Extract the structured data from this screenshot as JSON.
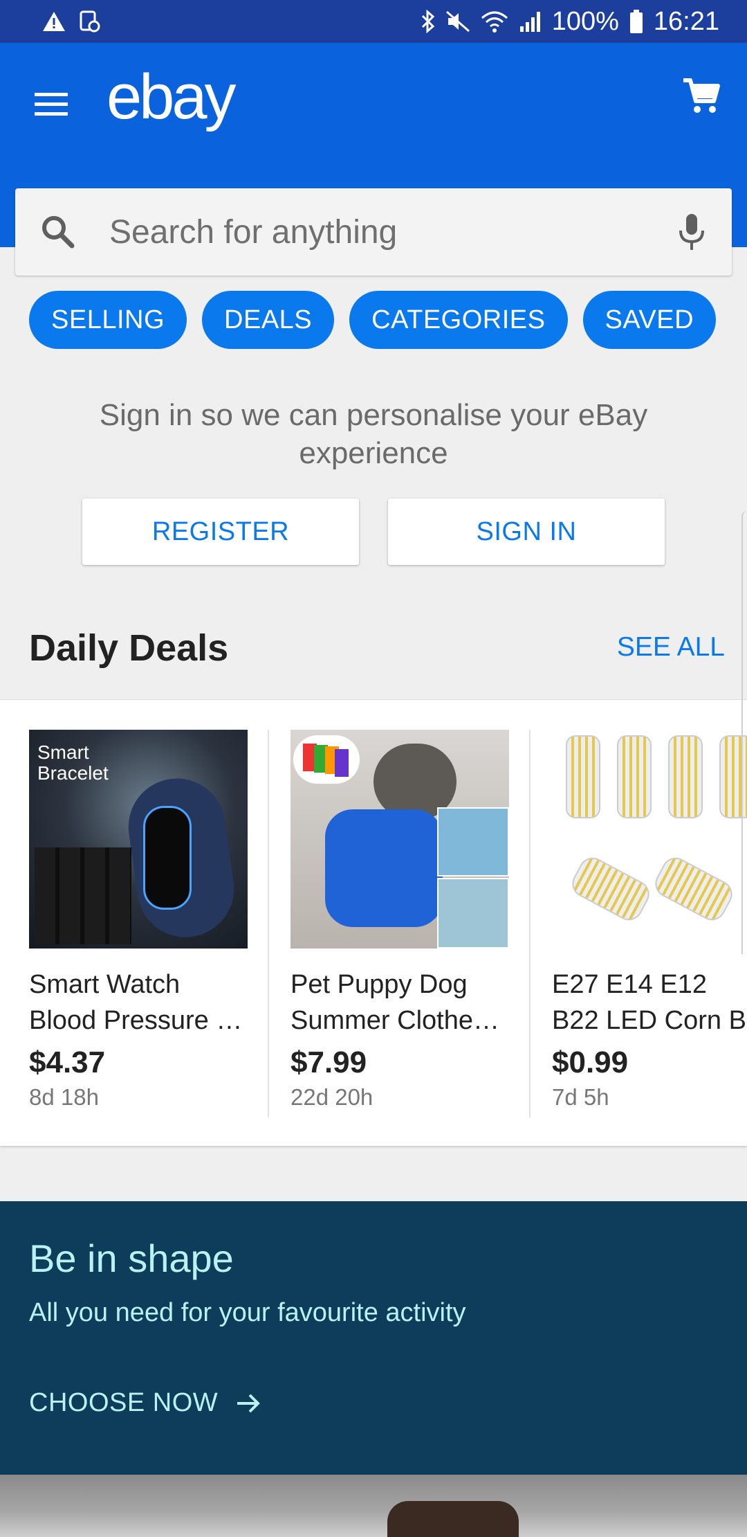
{
  "status_bar": {
    "battery": "100%",
    "time": "16:21"
  },
  "app_bar": {
    "logo": "ebay"
  },
  "search": {
    "placeholder": "Search for anything"
  },
  "chips": [
    {
      "label": "SELLING"
    },
    {
      "label": "DEALS"
    },
    {
      "label": "CATEGORIES"
    },
    {
      "label": "SAVED"
    }
  ],
  "signin": {
    "message": "Sign in so we can personalise your eBay experience",
    "register_label": "REGISTER",
    "signin_label": "SIGN IN"
  },
  "daily_deals": {
    "title": "Daily Deals",
    "see_all": "SEE ALL",
    "items": [
      {
        "title_line1": "Smart Watch",
        "title_line2": "Blood Pressure …",
        "price": "$4.37",
        "time_left": "8d 18h",
        "image_text": "Smart Bracelet"
      },
      {
        "title_line1": "Pet Puppy Dog",
        "title_line2": "Summer Clothe…",
        "price": "$7.99",
        "time_left": "22d 20h"
      },
      {
        "title_line1": "E27 E14 E12",
        "title_line2": "B22 LED Corn B",
        "price": "$0.99",
        "time_left": "7d 5h"
      }
    ]
  },
  "promo": {
    "title": "Be in shape",
    "subtitle": "All you need for your favourite activity",
    "cta": "CHOOSE NOW"
  },
  "colors": {
    "status_bar": "#1c3f9e",
    "app_bar": "#0a63dd",
    "accent": "#0a79ee",
    "promo_bg": "#0e3d5c",
    "promo_text": "#b9f2f0"
  }
}
